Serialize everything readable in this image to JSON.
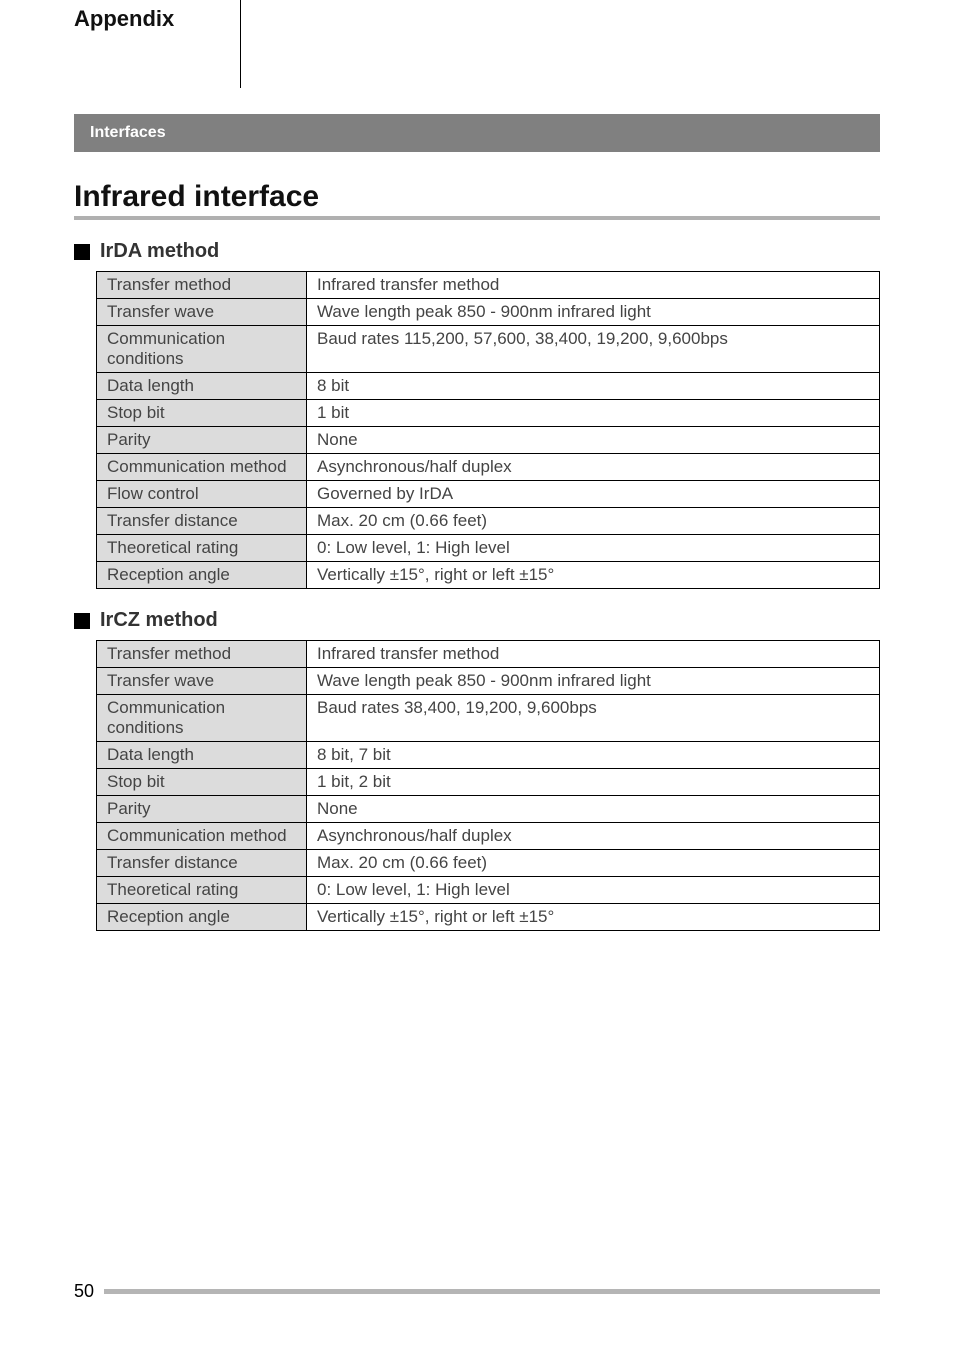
{
  "header": {
    "section": "Appendix"
  },
  "tabs": {
    "t1": "Interfaces"
  },
  "title": "Infrared interface",
  "s1": {
    "title": "IrDA method",
    "rows": {
      "r0": {
        "label": "Transfer method",
        "value": "Infrared transfer method"
      },
      "r1": {
        "label": "Transfer wave",
        "value": "Wave length peak 850 - 900nm infrared light"
      },
      "r2": {
        "label": "Communication conditions",
        "value": "Baud rates 115,200, 57,600, 38,400, 19,200, 9,600bps"
      },
      "r3": {
        "label": "Data length",
        "value": "8 bit"
      },
      "r4": {
        "label": "Stop bit",
        "value": "1 bit"
      },
      "r5": {
        "label": "Parity",
        "value": "None"
      },
      "r6": {
        "label": "Communication method",
        "value": "Asynchronous/half duplex"
      },
      "r7": {
        "label": "Flow control",
        "value": "Governed by IrDA"
      },
      "r8": {
        "label": "Transfer distance",
        "value": "Max. 20 cm (0.66 feet)"
      },
      "r9": {
        "label": "Theoretical rating",
        "value": "0: Low level, 1: High level"
      },
      "r10": {
        "label": "Reception angle",
        "value": "Vertically ±15°, right or left ±15°"
      }
    }
  },
  "s2": {
    "title": "IrCZ method",
    "rows": {
      "r0": {
        "label": "Transfer method",
        "value": "Infrared transfer method"
      },
      "r1": {
        "label": "Transfer wave",
        "value": "Wave length peak 850 - 900nm infrared light"
      },
      "r2": {
        "label": "Communication conditions",
        "value": "Baud rates 38,400, 19,200, 9,600bps"
      },
      "r3": {
        "label": "Data length",
        "value": "8 bit, 7 bit"
      },
      "r4": {
        "label": "Stop bit",
        "value": "1 bit, 2 bit"
      },
      "r5": {
        "label": "Parity",
        "value": "None"
      },
      "r6": {
        "label": "Communication method",
        "value": "Asynchronous/half duplex"
      },
      "r7": {
        "label": "Transfer distance",
        "value": "Max. 20 cm (0.66 feet)"
      },
      "r8": {
        "label": "Theoretical rating",
        "value": "0: Low level, 1: High level"
      },
      "r9": {
        "label": "Reception angle",
        "value": "Vertically ±15°, right or left ±15°"
      }
    }
  },
  "page_number": "50"
}
